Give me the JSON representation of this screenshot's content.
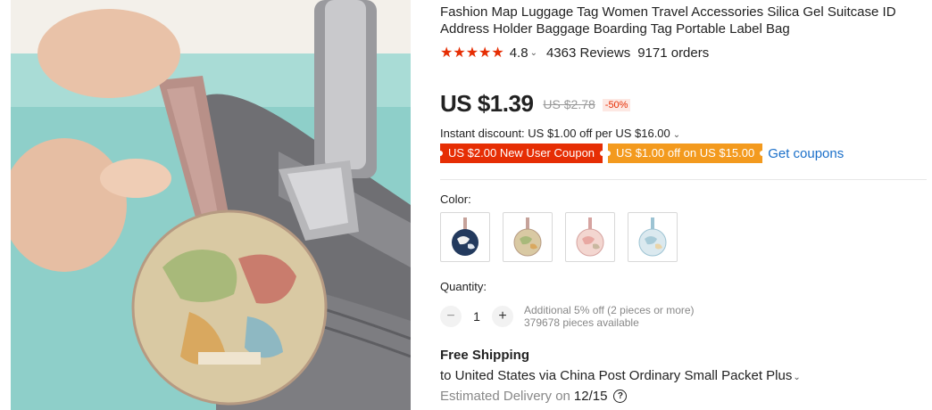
{
  "product": {
    "title": "Fashion Map Luggage Tag Women Travel Accessories Silica Gel Suitcase ID Address Holder Baggage Boarding Tag Portable Label Bag",
    "image_icon": "luggage-tag-photo"
  },
  "rating": {
    "stars": "★★★★★",
    "score": "4.8",
    "reviews": "4363 Reviews",
    "orders": "9171 orders",
    "star_color": "#e62e04"
  },
  "pricing": {
    "price": "US $1.39",
    "original_price": "US $2.78",
    "discount": "-50%",
    "instant_discount": "Instant discount: US $1.00 off per US $16.00"
  },
  "coupons": {
    "new_user": "US $2.00 New User Coupon",
    "store": "US $1.00 off on US $15.00",
    "get_coupons": "Get coupons",
    "new_user_color": "#e62e04",
    "store_color": "#f39a1e",
    "link_color": "#1a6fc9"
  },
  "color": {
    "label": "Color:",
    "options": [
      "navy-map",
      "beige-map",
      "pink-map",
      "blue-map"
    ]
  },
  "quantity": {
    "label": "Quantity:",
    "value": "1",
    "minus": "−",
    "plus": "+",
    "note": "Additional 5% off (2 pieces or more)",
    "available": "379678 pieces available"
  },
  "shipping": {
    "title": "Free Shipping",
    "method": "to United States via China Post Ordinary Small Packet Plus",
    "estimate_label": "Estimated Delivery on",
    "estimate_date": "12/15",
    "help": "?"
  }
}
